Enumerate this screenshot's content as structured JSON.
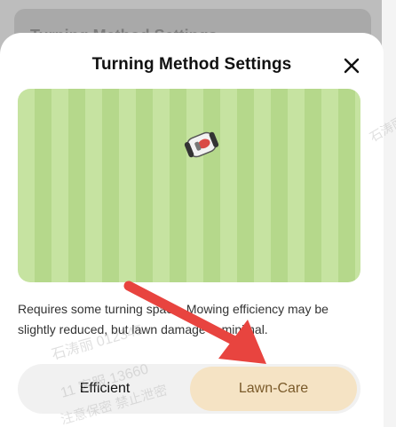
{
  "backdrop": {
    "title": "Turning Method Settings"
  },
  "dialog": {
    "title": "Turning Method Settings",
    "close_icon": "close-icon",
    "illustration": {
      "stripe_colors": [
        "#c6e3a1",
        "#b5d88b"
      ],
      "mower_icon": "robot-mower-icon"
    },
    "description": "Requires some turning space. Mowing efficiency may be slightly reduced, but lawn damage is minimal.",
    "options": [
      {
        "label": "Efficient",
        "selected": false
      },
      {
        "label": "Lawn-Care",
        "selected": true
      }
    ],
    "accent": "#f5e3c4"
  },
  "annotation": {
    "arrow_color": "#e8443f"
  },
  "watermark": {
    "line1": "石涛丽 012345",
    "line2": "11 客服 13660",
    "line3": "注意保密 禁止泄密",
    "line4": "石涛丽"
  }
}
